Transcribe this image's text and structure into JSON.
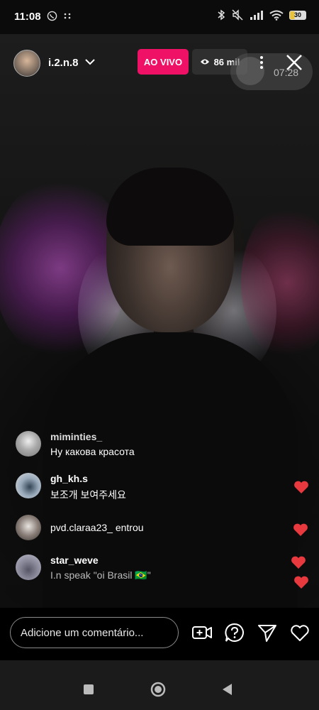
{
  "status_bar": {
    "time": "11:08",
    "left_icons": [
      "whatsapp-icon",
      "more-dots-icon"
    ],
    "right_icons": [
      "bluetooth-icon",
      "mute-icon",
      "signal-icon",
      "wifi-icon"
    ],
    "battery": "30",
    "battery_color": "#e8c33a"
  },
  "live": {
    "username": "i.2.n.8",
    "live_label": "AO VIVO",
    "viewers": "86 mil",
    "pip_timer": "07:28",
    "accent": "#ee1166"
  },
  "comments": [
    {
      "user": "miminties_",
      "text": "Ну какова красота",
      "liked": false
    },
    {
      "user": "gh_kh.s",
      "text": "보조개 보여주세요",
      "liked": true
    },
    {
      "user": "pvd.claraa23_",
      "text": "entrou",
      "liked": true,
      "is_join": true
    },
    {
      "user": "star_weve",
      "text": "I.n speak \"oi Brasil 🇧🇷\"",
      "liked": true
    }
  ],
  "comment_bar": {
    "placeholder": "Adicione um comentário...",
    "icons": [
      "add-video-icon",
      "question-icon",
      "send-icon",
      "heart-icon"
    ]
  },
  "nav": {
    "icons": [
      "recents-icon",
      "home-icon",
      "back-icon"
    ]
  }
}
